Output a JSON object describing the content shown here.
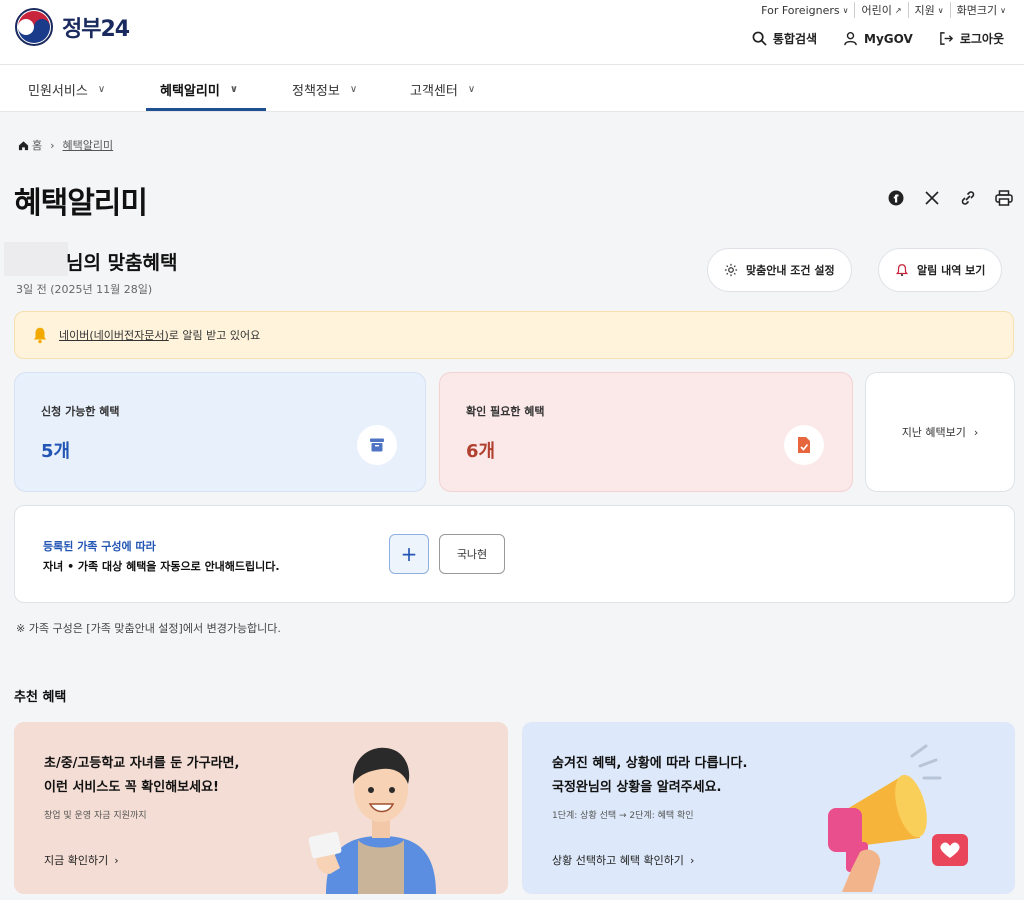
{
  "header": {
    "logo_text": "정부24",
    "util": [
      "For Foreigners",
      "어린이",
      "지원",
      "화면크기"
    ],
    "actions": {
      "search": "통합검색",
      "mygov": "MyGOV",
      "logout": "로그아웃"
    }
  },
  "nav": {
    "items": [
      "민원서비스",
      "혜택알리미",
      "정책정보",
      "고객센터"
    ],
    "active_index": 1
  },
  "breadcrumb": {
    "home": "홈",
    "current": "혜택알리미"
  },
  "page_title": "혜택알리미",
  "greeting": {
    "suffix": "님의 맞춤혜택",
    "date": "3일 전 (2025년 11월 28일)",
    "settings_button": "맞춤안내 조건 설정",
    "history_button": "알림 내역 보기"
  },
  "notice": {
    "link": "네이버(네이버전자문서)",
    "rest": "로 알림 받고 있어요"
  },
  "cards": {
    "available_label": "신청 가능한 혜택",
    "available_count": "5개",
    "check_label": "확인 필요한 혜택",
    "check_count": "6개",
    "past_label": "지난 혜택보기"
  },
  "family": {
    "line1": "등록된 가족 구성에 따라",
    "line2": "자녀 • 가족 대상 혜택을 자동으로 안내해드립니다.",
    "add": "+",
    "member": "국나현",
    "note": "※ 가족 구성은 [가족 맞춤안내 설정]에서 변경가능합니다."
  },
  "recommend": {
    "title": "추천 혜택",
    "banner1": {
      "line1": "초/중/고등학교 자녀를 둔 가구라면,",
      "line2": "이런 서비스도 꼭 확인해보세요!",
      "sub": "창업 및 운영 자금 지원까지",
      "cta": "지금 확인하기"
    },
    "banner2": {
      "line1": "숨겨진 혜택, 상황에 따라 다릅니다.",
      "line2": "국정완님의 상황을 알려주세요.",
      "sub": "1단계: 상황 선택 → 2단계: 혜택 확인",
      "cta": "상황 선택하고 혜택 확인하기"
    }
  },
  "colors": {
    "primary": "#1d4f91",
    "blue_count": "#2356b4",
    "red_count": "#b0402f",
    "notice_bg": "#fff3dc"
  }
}
